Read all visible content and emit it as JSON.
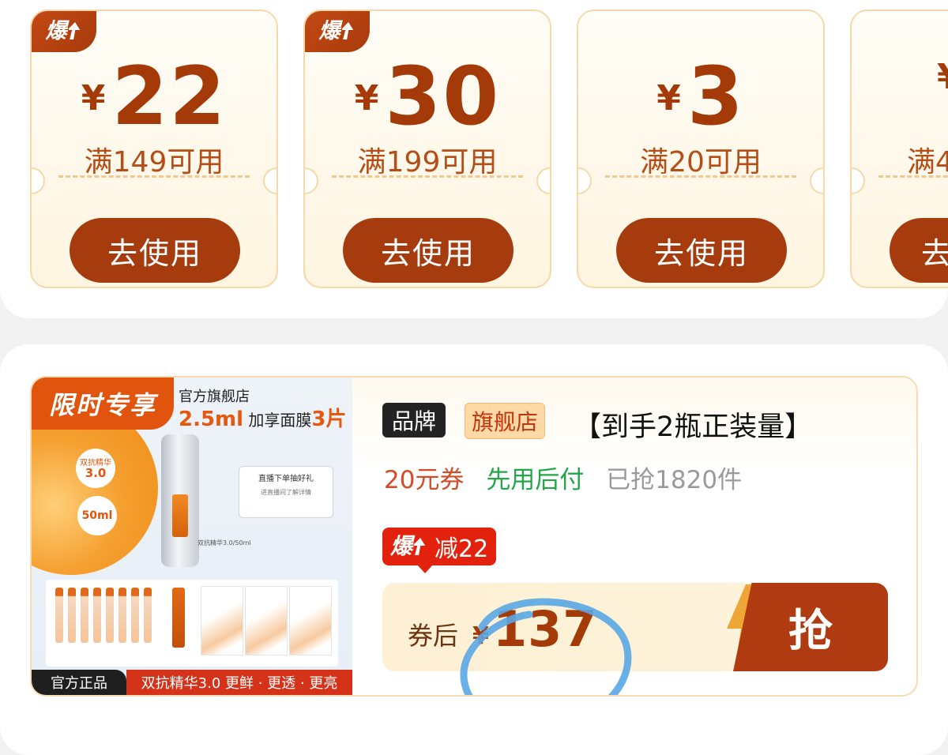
{
  "coupons": [
    {
      "hot": "爆",
      "currency": "¥",
      "amount": "22",
      "condition": "满149可用",
      "action": "去使用"
    },
    {
      "hot": "爆",
      "currency": "¥",
      "amount": "30",
      "condition": "满199可用",
      "action": "去使用"
    },
    {
      "hot": "",
      "currency": "¥",
      "amount": "3",
      "condition": "满20可用",
      "action": "去使用"
    },
    {
      "hot": "",
      "currency": "¥",
      "amount": "",
      "condition": "满4",
      "action": "去"
    }
  ],
  "product": {
    "image": {
      "limited_tag": "限时专享",
      "store_text": "官方旗舰店",
      "bonus_prefix": "2.5ml",
      "bonus_middle": " 加享面膜",
      "bonus_count": "3片",
      "essence_badge_top": "双抗精华",
      "essence_badge_version": "3.0",
      "ml_badge": "50ml",
      "gift_title": "直播下单抽好礼",
      "gift_sub": "进直播间了解详情",
      "bottle_caption": "双抗精华3.0/50ml",
      "genuine_tag": "官方正品",
      "slogan": "双抗精华3.0 更鲜 · 更透 · 更亮"
    },
    "brand_tag": "品牌",
    "store_tag": "旗舰店",
    "title": "【到手2瓶正装量】",
    "benefits": {
      "coupon": "20元券",
      "paylater": "先用后付",
      "sold": "已抢1820件"
    },
    "discount": {
      "hot": "爆",
      "text": "减22"
    },
    "price": {
      "label": "券后",
      "currency": "¥",
      "value": "137"
    },
    "buy_label": "抢"
  },
  "colors": {
    "brand_brown": "#a63b0e",
    "hot_red": "#e3220e",
    "annotation_blue": "#5aa7e6"
  }
}
